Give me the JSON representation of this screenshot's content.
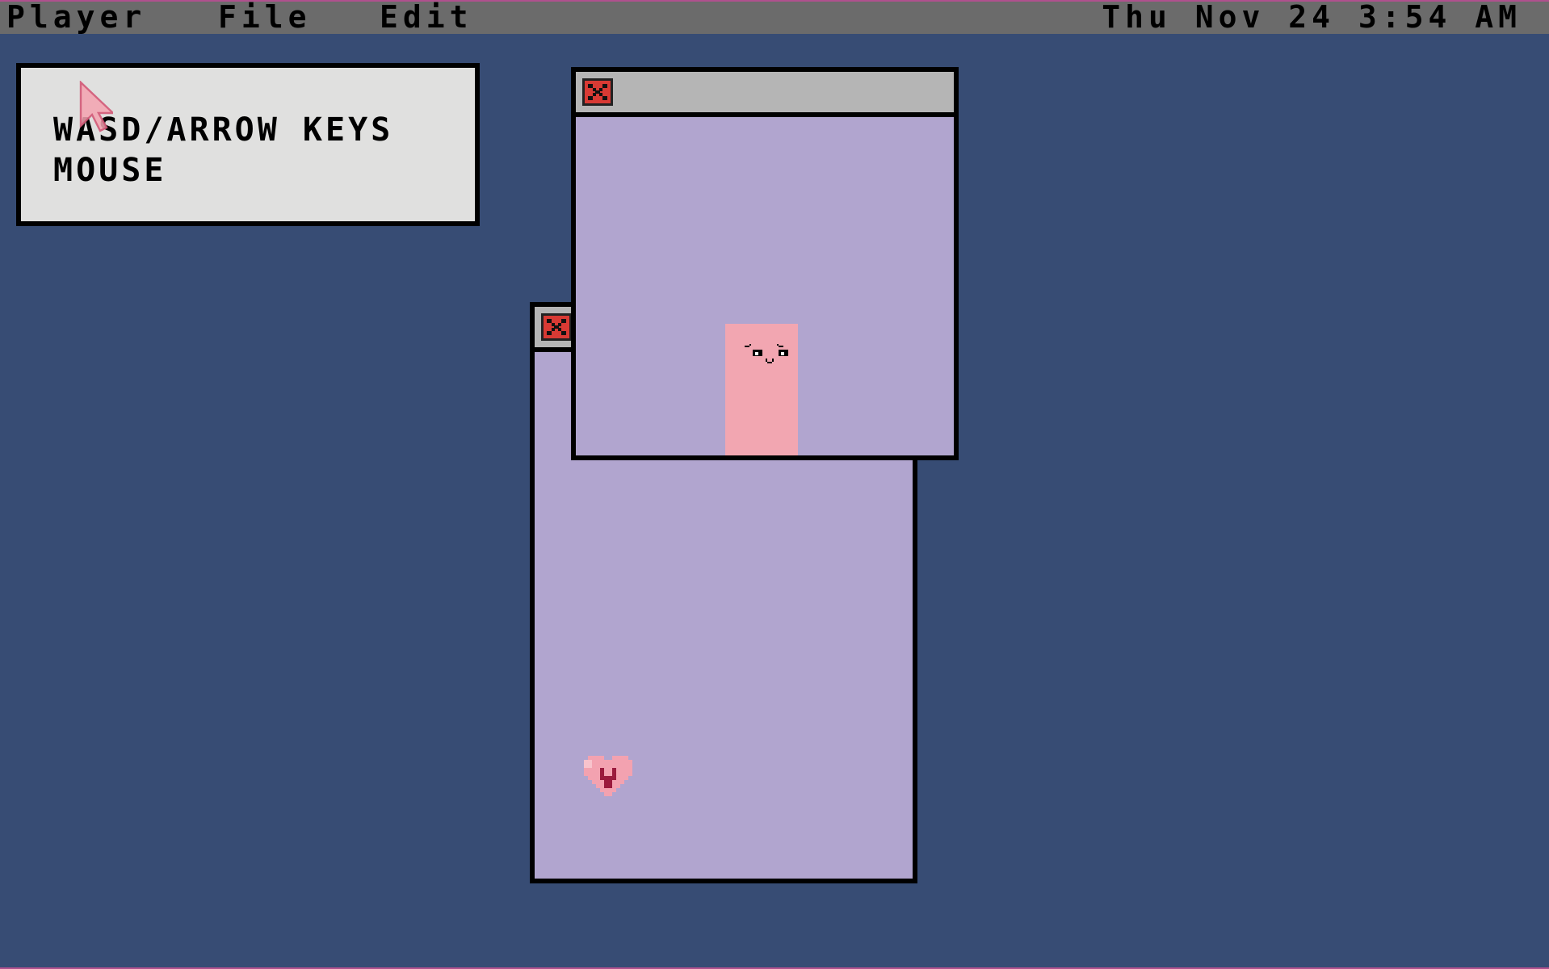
{
  "menubar": {
    "items": [
      "Player",
      "File",
      "Edit"
    ],
    "clock": "Thu Nov 24 3:54 AM"
  },
  "info_window": {
    "lines": [
      "WASD/ARROW KEYS",
      "MOUSE"
    ]
  },
  "windows": {
    "front": {
      "close_icon": "close-x-icon"
    },
    "back": {
      "close_icon": "close-x-icon"
    }
  },
  "sprites": {
    "player": "pink-block-character",
    "heart": "heart-icon",
    "cursor": "pointer-cursor-icon"
  },
  "colors": {
    "desktop": "#374c74",
    "menubar": "#6b6b6b",
    "window_body": "#b1a5cf",
    "info_window": "#e0e0df",
    "titlebar": "#b5b5b5",
    "close_button": "#d83a34",
    "player": "#f2a6b1",
    "heart": "#f3a2b0",
    "heart_letter": "#9b1b3d"
  }
}
